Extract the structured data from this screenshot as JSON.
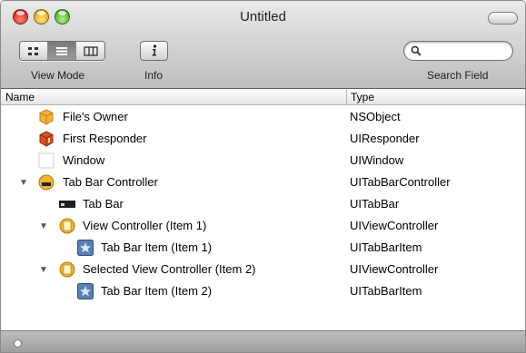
{
  "window": {
    "title": "Untitled"
  },
  "toolbar": {
    "view_mode_label": "View Mode",
    "info_label": "Info",
    "search_label": "Search Field",
    "search_value": "",
    "view_modes": [
      "icon-view",
      "list-view",
      "column-view"
    ],
    "active_view_mode": "list-view"
  },
  "columns": {
    "name": "Name",
    "type": "Type"
  },
  "rows": [
    {
      "name": "File's Owner",
      "type": "NSObject",
      "icon": "cube-icon",
      "depth": 0,
      "disclosure": null
    },
    {
      "name": "First Responder",
      "type": "UIResponder",
      "icon": "first-responder-icon",
      "depth": 0,
      "disclosure": null
    },
    {
      "name": "Window",
      "type": "UIWindow",
      "icon": "window-icon",
      "depth": 0,
      "disclosure": null
    },
    {
      "name": "Tab Bar Controller",
      "type": "UITabBarController",
      "icon": "tab-bar-controller-icon",
      "depth": 0,
      "disclosure": "expanded"
    },
    {
      "name": "Tab Bar",
      "type": "UITabBar",
      "icon": "tab-bar-icon",
      "depth": 1,
      "disclosure": null
    },
    {
      "name": "View Controller (Item 1)",
      "type": "UIViewController",
      "icon": "view-controller-icon",
      "depth": 1,
      "disclosure": "expanded"
    },
    {
      "name": "Tab Bar Item (Item 1)",
      "type": "UITabBarItem",
      "icon": "tab-bar-item-icon",
      "depth": 2,
      "disclosure": null
    },
    {
      "name": "Selected View Controller (Item 2)",
      "type": "UIViewController",
      "icon": "view-controller-icon",
      "depth": 1,
      "disclosure": "expanded"
    },
    {
      "name": "Tab Bar Item (Item 2)",
      "type": "UITabBarItem",
      "icon": "tab-bar-item-icon",
      "depth": 2,
      "disclosure": null
    }
  ]
}
